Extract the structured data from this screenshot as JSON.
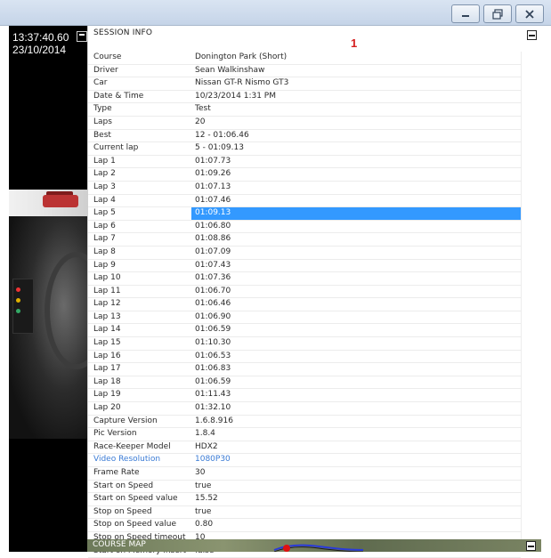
{
  "video": {
    "time": "13:37:40.60",
    "date": "23/10/2014"
  },
  "session": {
    "title": "SESSION INFO",
    "marker": "1",
    "rows": [
      {
        "label": "Course",
        "value": "Donington Park (Short)"
      },
      {
        "label": "Driver",
        "value": "Sean Walkinshaw"
      },
      {
        "label": "Car",
        "value": "Nissan GT-R Nismo GT3"
      },
      {
        "label": "Date & Time",
        "value": "10/23/2014 1:31 PM"
      },
      {
        "label": "Type",
        "value": "Test"
      },
      {
        "label": "Laps",
        "value": "20"
      },
      {
        "label": "Best",
        "value": "12 - 01:06.46"
      },
      {
        "label": "Current lap",
        "value": "5 - 01:09.13"
      },
      {
        "label": "Lap 1",
        "value": "01:07.73"
      },
      {
        "label": "Lap 2",
        "value": "01:09.26"
      },
      {
        "label": "Lap 3",
        "value": "01:07.13"
      },
      {
        "label": "Lap 4",
        "value": "01:07.46"
      },
      {
        "label": "Lap 5",
        "value": "01:09.13"
      },
      {
        "label": "Lap 6",
        "value": "01:06.80"
      },
      {
        "label": "Lap 7",
        "value": "01:08.86"
      },
      {
        "label": "Lap 8",
        "value": "01:07.09"
      },
      {
        "label": "Lap 9",
        "value": "01:07.43"
      },
      {
        "label": "Lap 10",
        "value": "01:07.36"
      },
      {
        "label": "Lap 11",
        "value": "01:06.70"
      },
      {
        "label": "Lap 12",
        "value": "01:06.46"
      },
      {
        "label": "Lap 13",
        "value": "01:06.90"
      },
      {
        "label": "Lap 14",
        "value": "01:06.59"
      },
      {
        "label": "Lap 15",
        "value": "01:10.30"
      },
      {
        "label": "Lap 16",
        "value": "01:06.53"
      },
      {
        "label": "Lap 17",
        "value": "01:06.83"
      },
      {
        "label": "Lap 18",
        "value": "01:06.59"
      },
      {
        "label": "Lap 19",
        "value": "01:11.43"
      },
      {
        "label": "Lap 20",
        "value": "01:32.10"
      },
      {
        "label": "Capture Version",
        "value": "1.6.8.916"
      },
      {
        "label": "Pic Version",
        "value": "1.8.4"
      },
      {
        "label": "Race-Keeper Model",
        "value": "HDX2"
      },
      {
        "label": "Video Resolution",
        "value": "1080P30"
      },
      {
        "label": "Frame Rate",
        "value": "30"
      },
      {
        "label": "Start on Speed",
        "value": "true"
      },
      {
        "label": "Start on Speed value",
        "value": "15.52"
      },
      {
        "label": "Stop on Speed",
        "value": "true"
      },
      {
        "label": "Stop on Speed value",
        "value": "0.80"
      },
      {
        "label": "Stop on Speed timeout",
        "value": "10"
      },
      {
        "label": "Start on Memory insert",
        "value": "false"
      }
    ],
    "selected_row": "Lap 5",
    "highlight_color": "#3399ff",
    "link_row": "Video Resolution"
  },
  "course_map": {
    "title": "COURSE MAP"
  },
  "window": {
    "buttons": [
      "minimize-icon",
      "restore-icon",
      "close-icon"
    ]
  }
}
